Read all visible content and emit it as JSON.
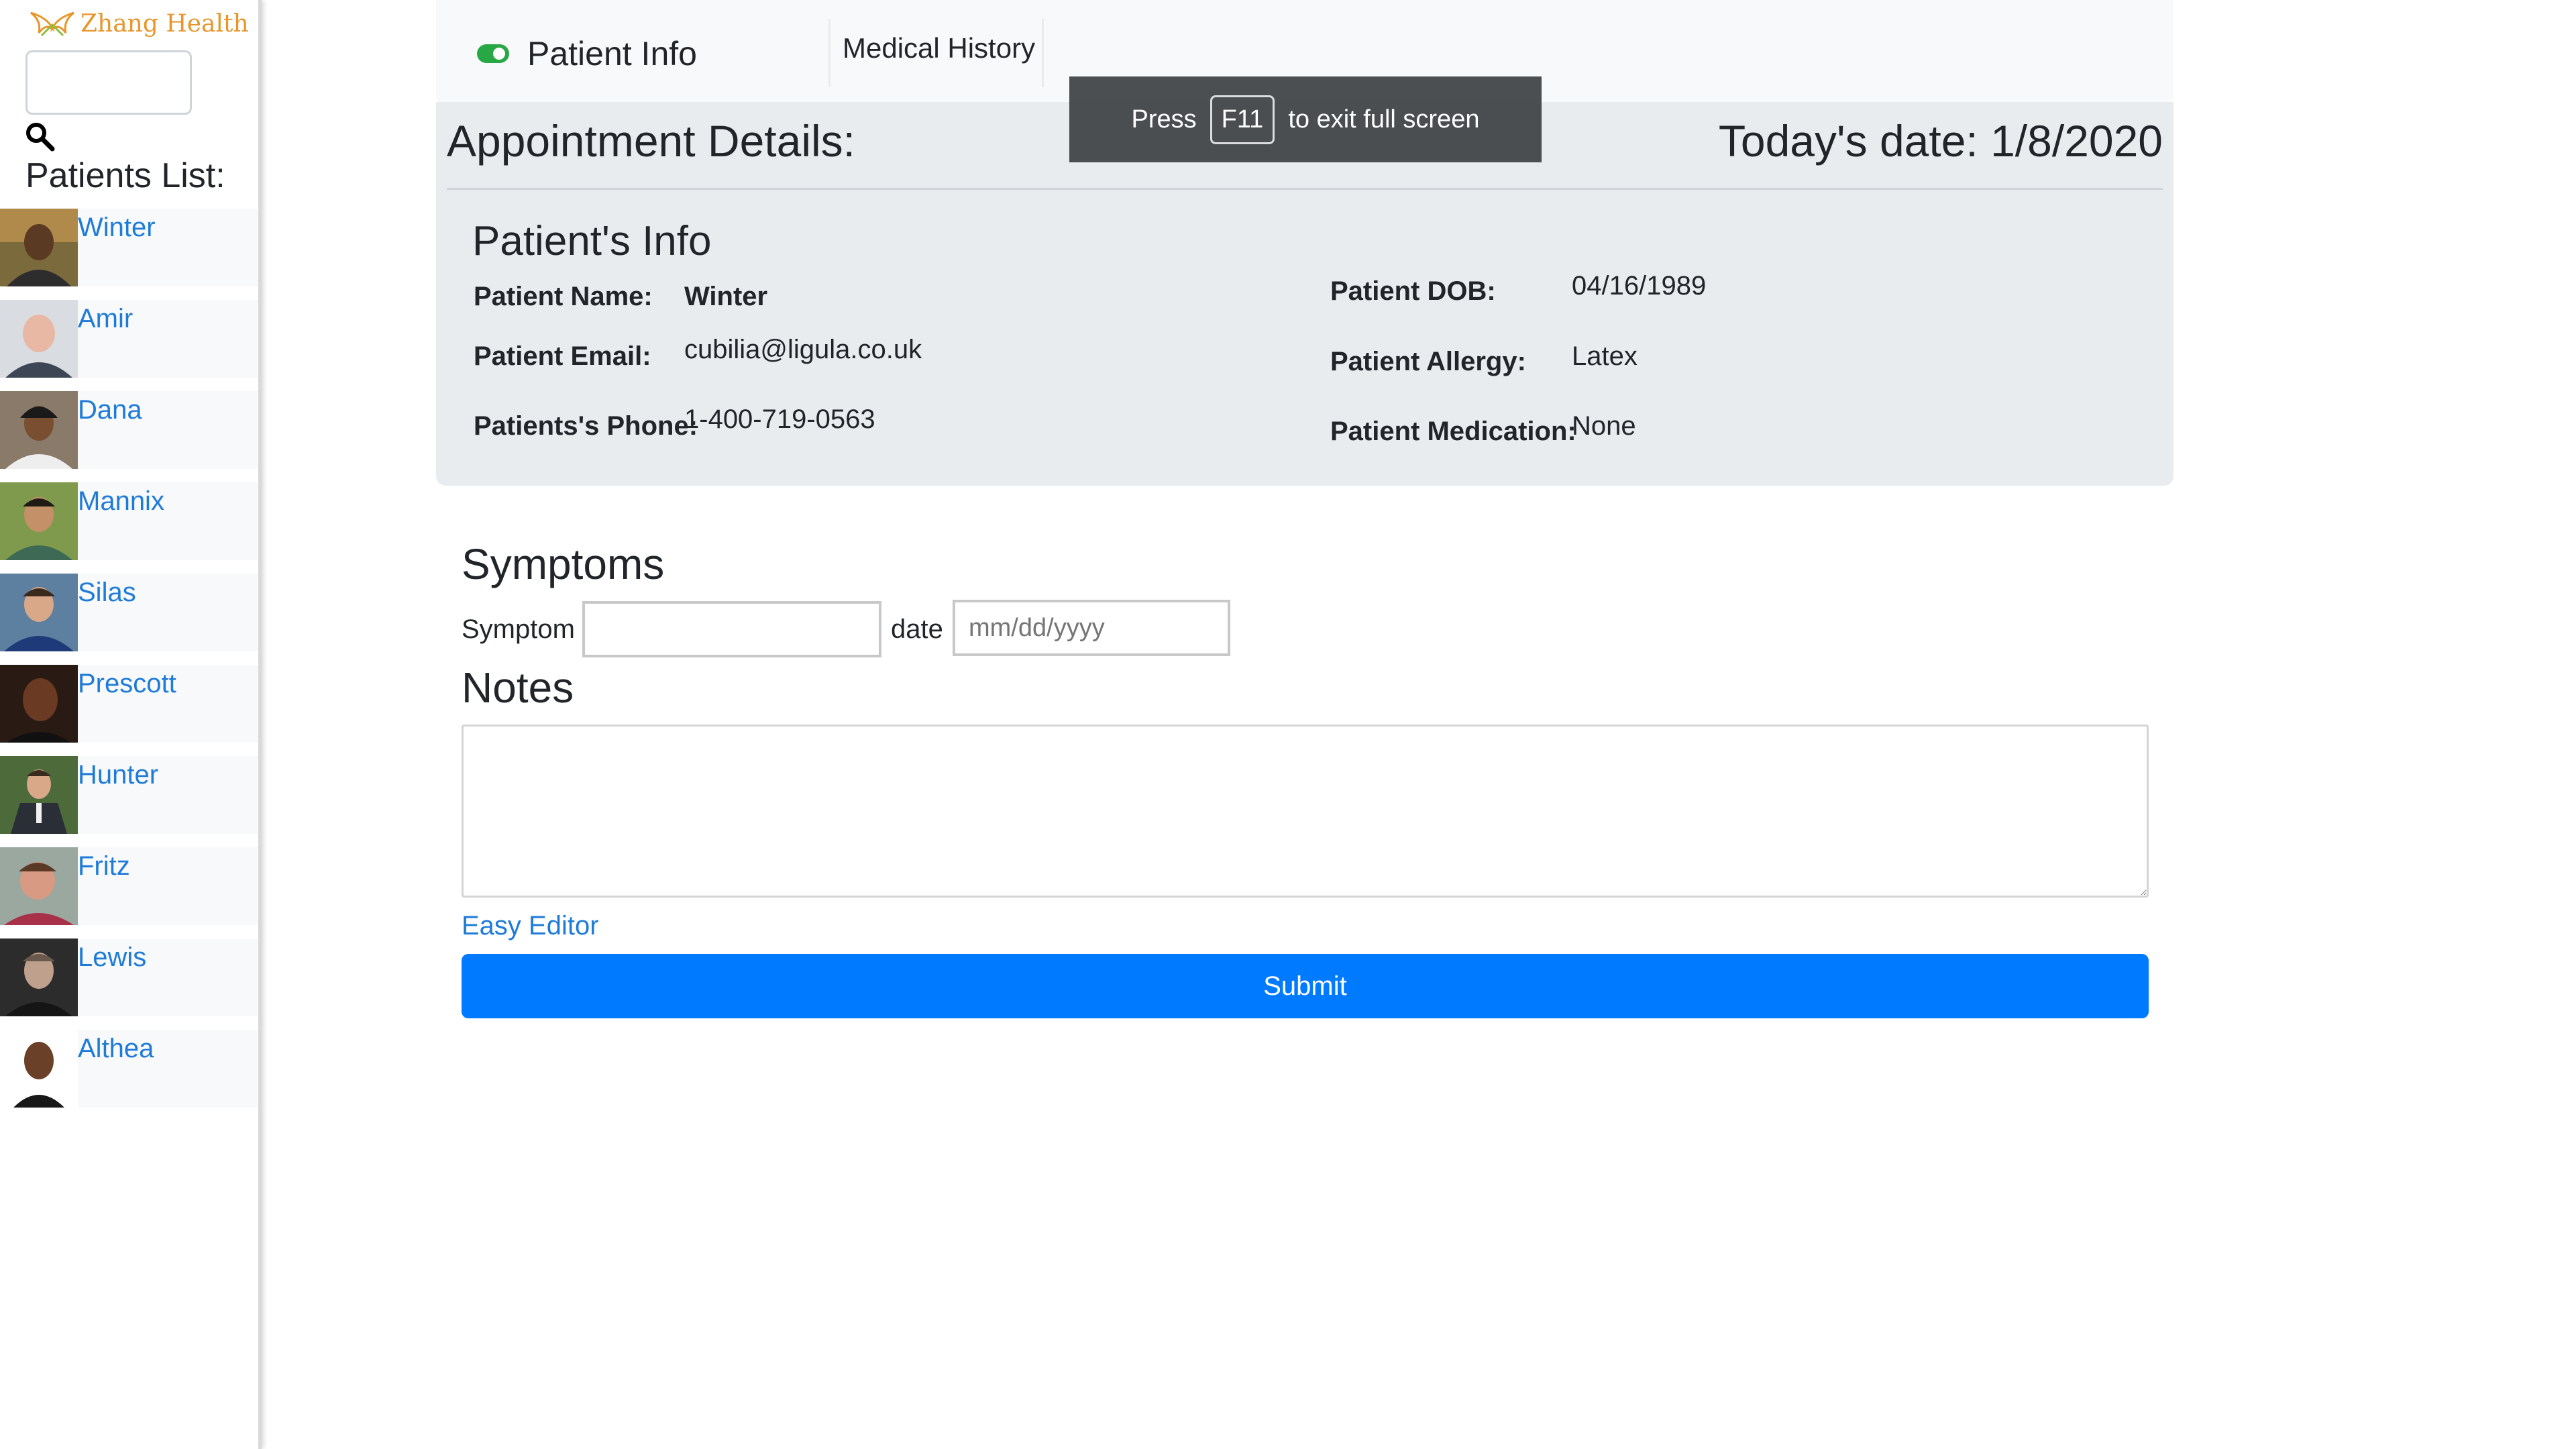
{
  "brand": {
    "name": "Zhang Health",
    "accent_color": "#e8962b"
  },
  "sidebar": {
    "search": {
      "value": "",
      "icon": "search-icon"
    },
    "heading": "Patients List:",
    "patients": [
      {
        "name": "Winter"
      },
      {
        "name": "Amir"
      },
      {
        "name": "Dana"
      },
      {
        "name": "Mannix"
      },
      {
        "name": "Silas"
      },
      {
        "name": "Prescott"
      },
      {
        "name": "Hunter"
      },
      {
        "name": "Fritz"
      },
      {
        "name": "Lewis"
      },
      {
        "name": "Althea"
      }
    ]
  },
  "tabs": {
    "patient_info": "Patient Info",
    "medical_history": "Medical History"
  },
  "appointment": {
    "title": "Appointment Details:",
    "today": "Today's date: 1/8/2020",
    "info_heading": "Patient's Info",
    "fields": {
      "name_label": "Patient Name:",
      "name_value": "Winter",
      "email_label": "Patient Email:",
      "email_value": "cubilia@ligula.co.uk",
      "phone_label": "Patients's Phone:",
      "phone_value": "1-400-719-0563",
      "dob_label": "Patient DOB:",
      "dob_value": "04/16/1989",
      "allergy_label": "Patient Allergy:",
      "allergy_value": "Latex",
      "medication_label": "Patient Medication:",
      "medication_value": "None"
    }
  },
  "form": {
    "symptoms_heading": "Symptoms",
    "symptom_label": "Symptom",
    "symptom_value": "",
    "date_label": "date",
    "date_placeholder": "mm/dd/yyyy",
    "notes_heading": "Notes",
    "notes_value": "",
    "easy_editor": "Easy Editor",
    "submit": "Submit",
    "submit_color": "#007bff"
  },
  "overlay": {
    "press": "Press",
    "key": "F11",
    "message": "to exit full screen"
  }
}
